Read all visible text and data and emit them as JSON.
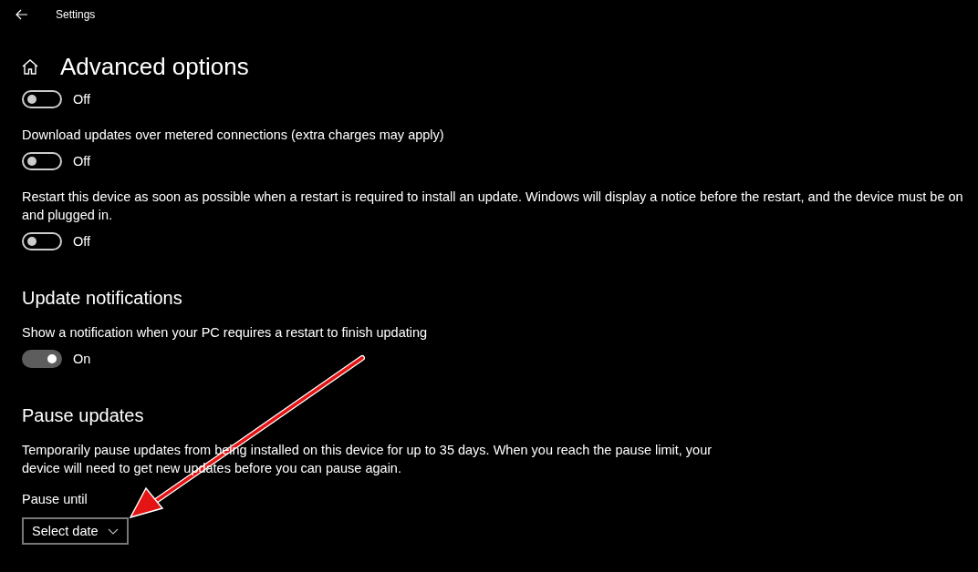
{
  "header": {
    "title": "Settings"
  },
  "page_title": "Advanced options",
  "blocks": [
    {
      "kind": "toggle",
      "on": false,
      "label": "Off"
    },
    {
      "kind": "text",
      "text": "Download updates over metered connections (extra charges may apply)"
    },
    {
      "kind": "toggle",
      "on": false,
      "label": "Off"
    },
    {
      "kind": "text",
      "text": "Restart this device as soon as possible when a restart is required to install an update. Windows will display a notice before the restart, and the device must be on and plugged in."
    },
    {
      "kind": "toggle",
      "on": false,
      "label": "Off"
    },
    {
      "kind": "heading",
      "text": "Update notifications"
    },
    {
      "kind": "text",
      "text": "Show a notification when your PC requires a restart to finish updating"
    },
    {
      "kind": "toggle",
      "on": true,
      "label": "On"
    },
    {
      "kind": "heading",
      "text": "Pause updates"
    },
    {
      "kind": "paragraph",
      "text": "Temporarily pause updates from being installed on this device for up to 35 days. When you reach the pause limit, your device will need to get new updates before you can pause again."
    },
    {
      "kind": "label",
      "text": "Pause until"
    },
    {
      "kind": "dropdown",
      "value": "Select date"
    }
  ]
}
